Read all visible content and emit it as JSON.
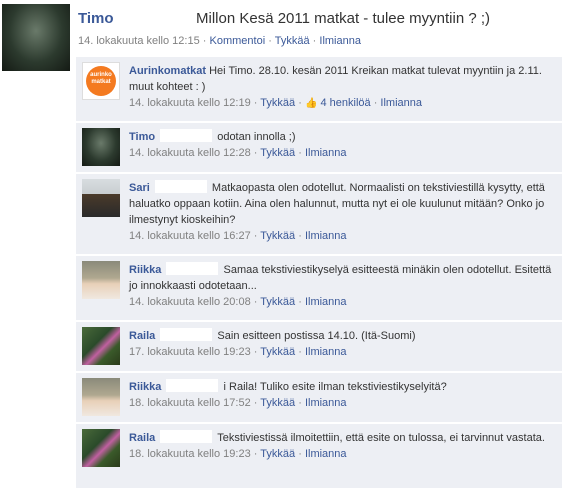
{
  "post": {
    "author": "Timo",
    "text": "Millon Kesä 2011 matkat - tulee myyntiin ? ;)",
    "timestamp": "14. lokakuuta kello 12:15",
    "comment_label": "Kommentoi",
    "like_label": "Tykkää",
    "report_label": "Ilmianna",
    "separator": "·"
  },
  "comments": [
    {
      "author": "Aurinkomatkat",
      "text": "Hei Timo. 28.10. kesän 2011 Kreikan matkat tulevat myyntiin ja 2.11. muut kohteet : )",
      "timestamp": "14. lokakuuta kello 12:19",
      "like_label": "Tykkää",
      "likes": "4 henkilöä",
      "report_label": "Ilmianna",
      "logo_text": "aurinko matkat"
    },
    {
      "author": "Timo",
      "text": "odotan innolla ;)",
      "timestamp": "14. lokakuuta kello 12:28",
      "like_label": "Tykkää",
      "report_label": "Ilmianna"
    },
    {
      "author": "Sari",
      "text": "Matkaopasta olen odotellut. Normaalisti on tekstiviestillä kysytty, että haluatko oppaan kotiin. Aina olen halunnut, mutta nyt ei ole kuulunut mitään? Onko jo ilmestynyt kioskeihin?",
      "timestamp": "14. lokakuuta kello 16:27",
      "like_label": "Tykkää",
      "report_label": "Ilmianna"
    },
    {
      "author": "Riikka",
      "text": "Samaa tekstiviestikyselyä esitteestä minäkin olen odotellut. Esitettä jo innokkaasti odotetaan...",
      "timestamp": "14. lokakuuta kello 20:08",
      "like_label": "Tykkää",
      "report_label": "Ilmianna"
    },
    {
      "author": "Raila",
      "text": "Sain esitteen postissa 14.10. (Itä-Suomi)",
      "timestamp": "17. lokakuuta kello 19:23",
      "like_label": "Tykkää",
      "report_label": "Ilmianna"
    },
    {
      "author": "Riikka",
      "text": "i Raila! Tuliko esite ilman tekstiviestikyselyitä?",
      "timestamp": "18. lokakuuta kello 17:52",
      "like_label": "Tykkää",
      "report_label": "Ilmianna"
    },
    {
      "author": "Raila",
      "text": "Tekstiviestissä ilmoitettiin, että esite on tulossa, ei tarvinnut vastata.",
      "timestamp": "18. lokakuuta kello 19:23",
      "like_label": "Tykkää",
      "report_label": "Ilmianna"
    }
  ],
  "colors": {
    "link": "#3b5998",
    "comment_bg": "#edeff4",
    "meta": "#808080"
  }
}
